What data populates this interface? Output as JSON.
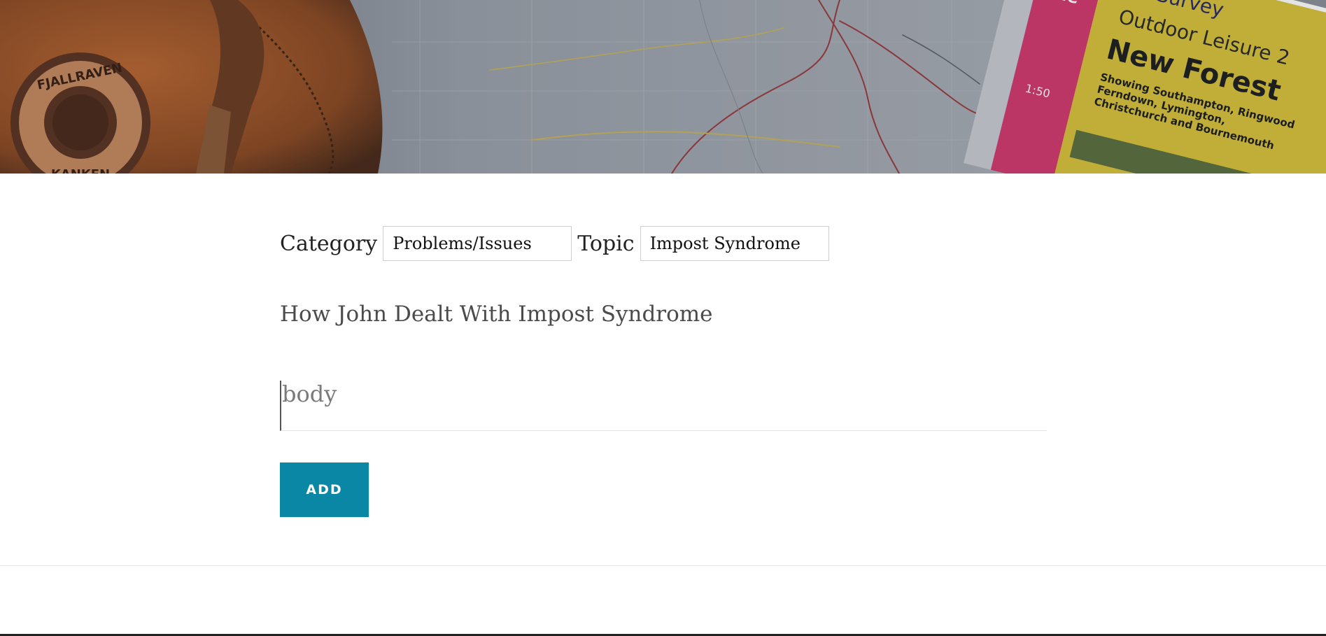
{
  "form": {
    "category_label": "Category",
    "category_value": "Problems/Issues",
    "topic_label": "Topic",
    "topic_value": "Impost Syndrome",
    "title_value": "How John Dealt With Impost Syndrome",
    "body_placeholder": "body",
    "add_label": "ADD"
  },
  "header": {
    "backpack_badge_text": "FJALLRAVEN KANKEN",
    "map_cover_brand": "Survey",
    "map_cover_series": "Outdoor Leisure 2",
    "map_cover_title": "New Forest",
    "map_cover_subtitle": "Showing Southampton, Ringwood Ferndown, Lymington, Christchurch and Bournemouth",
    "map_cover_scale": "1:50",
    "colors": {
      "backpack": "#a65a2c",
      "map_overlay": "#8d939c",
      "cover_yellow": "#d8c23a",
      "cover_pink": "#d23a6c"
    }
  },
  "colors": {
    "accent": "#0b87a6"
  }
}
